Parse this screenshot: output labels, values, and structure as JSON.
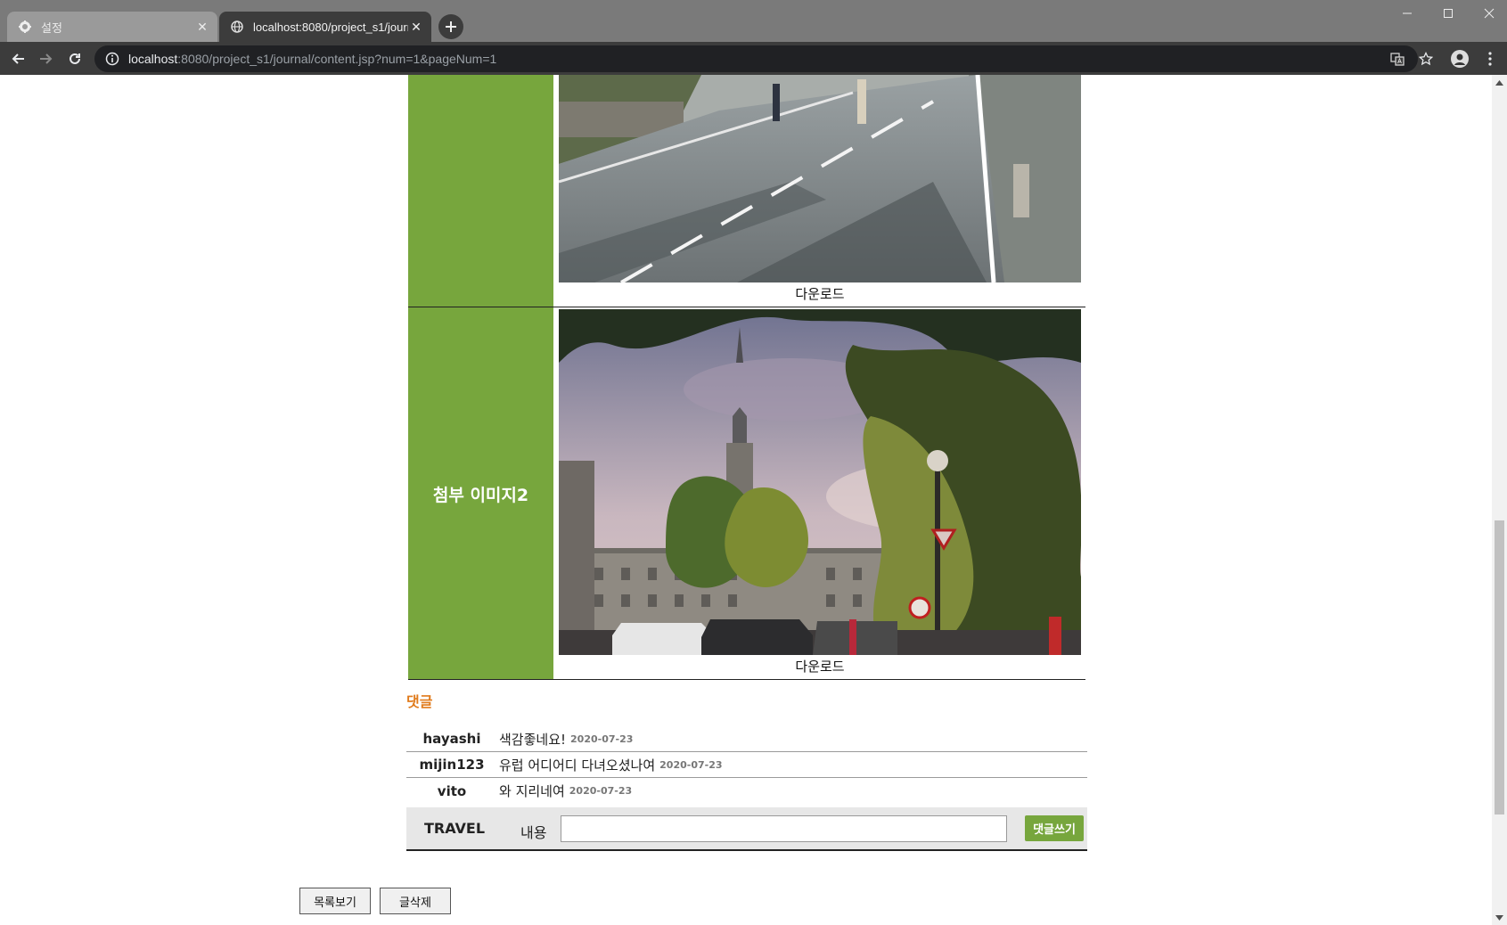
{
  "browser": {
    "tabs": [
      {
        "title": "설정",
        "icon": "gear-icon"
      },
      {
        "title": "localhost:8080/project_s1/journal/content.jsp?num=1&pageNum=1",
        "icon": "globe-icon"
      }
    ],
    "url_host": "localhost",
    "url_rest": ":8080/project_s1/journal/content.jsp?num=1&pageNum=1"
  },
  "attachments": [
    {
      "label": "",
      "download": "다운로드"
    },
    {
      "label": "첨부 이미지2",
      "download": "다운로드"
    }
  ],
  "comments": {
    "title": "댓글",
    "items": [
      {
        "user": "hayashi",
        "text": "색감좋네요!",
        "date": "2020-07-23"
      },
      {
        "user": "mijin123",
        "text": "유럽 어디어디 다녀오셨나여",
        "date": "2020-07-23"
      },
      {
        "user": "vito",
        "text": "와 지리네여",
        "date": "2020-07-23"
      }
    ],
    "write": {
      "user": "TRAVEL",
      "label": "내용",
      "value": "",
      "button": "댓글쓰기"
    }
  },
  "buttons": {
    "list": "목록보기",
    "delete": "글삭제"
  },
  "colors": {
    "label_bg": "#77a63d",
    "comment_title": "#e07b1c",
    "write_btn": "#77a63d"
  }
}
